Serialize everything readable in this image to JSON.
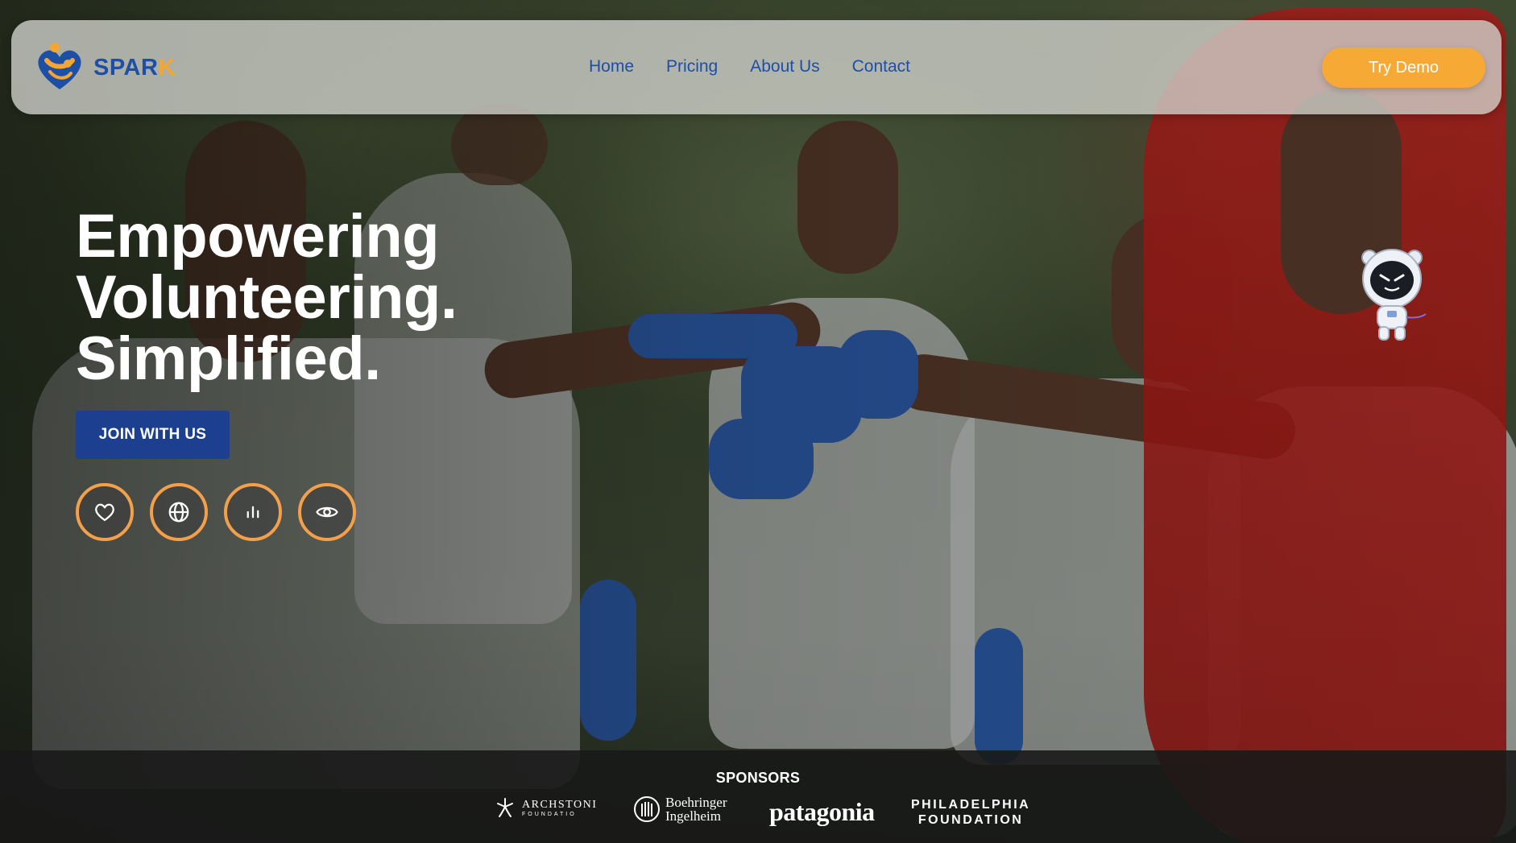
{
  "brand": {
    "name_main": "SPAR",
    "name_accent": "K"
  },
  "nav": {
    "items": [
      {
        "label": "Home"
      },
      {
        "label": "Pricing"
      },
      {
        "label": "About Us"
      },
      {
        "label": "Contact"
      }
    ],
    "demo_label": "Try Demo"
  },
  "hero": {
    "headline_lines": [
      "Empowering",
      "Volunteering.",
      "Simplified."
    ],
    "cta_label": "JOIN WITH US",
    "feature_icons": [
      "heart-icon",
      "globe-icon",
      "bar-chart-icon",
      "eye-icon"
    ]
  },
  "sponsors": {
    "title": "SPONSORS",
    "logos": [
      {
        "name": "ARCHSTONI",
        "sub": "FOUNDATIO"
      },
      {
        "line1": "Boehringer",
        "line2": "Ingelheim"
      },
      {
        "name": "patagonia"
      },
      {
        "line1": "PHILADELPHIA",
        "line2": "FOUNDATION"
      }
    ]
  },
  "colors": {
    "brand_blue": "#1c4fa8",
    "accent_orange": "#f7a936",
    "cta_blue": "#1d3f8f",
    "icon_ring": "#f4a04b"
  }
}
